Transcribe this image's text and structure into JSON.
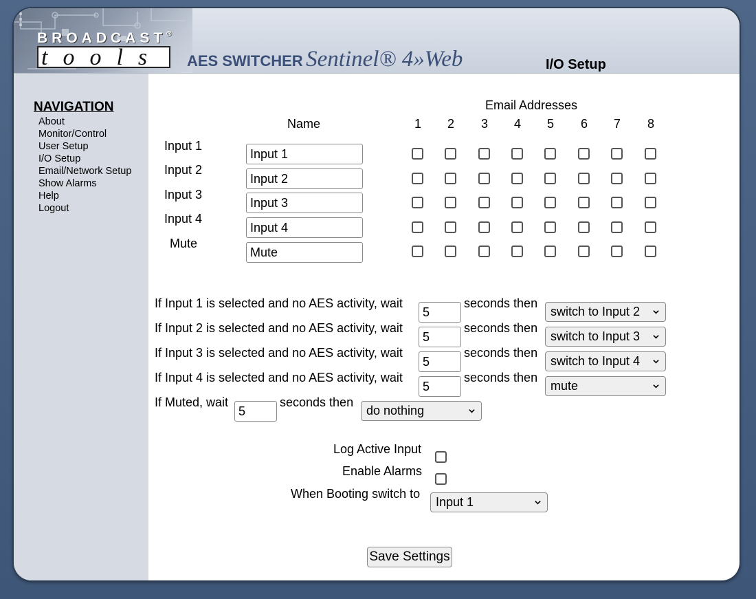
{
  "header": {
    "logo_broadcast": "BROADCAST",
    "logo_reg": "®",
    "logo_tools": "tools",
    "product_part1": "AES SWITCHER",
    "product_part2": "Sentinel® 4»Web",
    "page_title": "I/O Setup"
  },
  "nav": {
    "title": "NAVIGATION",
    "items": [
      "About",
      "Monitor/Control",
      "User Setup",
      "I/O Setup",
      "Email/Network Setup",
      "Show Alarms",
      "Help",
      "Logout"
    ]
  },
  "io_table": {
    "email_header": "Email Addresses",
    "name_header": "Name",
    "email_columns": [
      "1",
      "2",
      "3",
      "4",
      "5",
      "6",
      "7",
      "8"
    ],
    "rows": [
      {
        "label": "Input 1",
        "name": "Input 1",
        "emails": [
          false,
          false,
          false,
          false,
          false,
          false,
          false,
          false
        ]
      },
      {
        "label": "Input 2",
        "name": "Input 2",
        "emails": [
          false,
          false,
          false,
          false,
          false,
          false,
          false,
          false
        ]
      },
      {
        "label": "Input 3",
        "name": "Input 3",
        "emails": [
          false,
          false,
          false,
          false,
          false,
          false,
          false,
          false
        ]
      },
      {
        "label": "Input 4",
        "name": "Input 4",
        "emails": [
          false,
          false,
          false,
          false,
          false,
          false,
          false,
          false
        ]
      },
      {
        "label": "Mute",
        "name": "Mute",
        "emails": [
          false,
          false,
          false,
          false,
          false,
          false,
          false,
          false
        ]
      }
    ]
  },
  "failover": {
    "rules": [
      {
        "prefix": "If Input 1 is selected and no AES activity, wait",
        "seconds": "5",
        "suffix": "seconds then",
        "action": "switch to Input 2"
      },
      {
        "prefix": "If Input 2 is selected and no AES activity, wait",
        "seconds": "5",
        "suffix": "seconds then",
        "action": "switch to Input 3"
      },
      {
        "prefix": "If Input 3 is selected and no AES activity, wait",
        "seconds": "5",
        "suffix": "seconds then",
        "action": "switch to Input 4"
      },
      {
        "prefix": "If Input 4 is selected and no AES activity, wait",
        "seconds": "5",
        "suffix": "seconds then",
        "action": "mute"
      }
    ],
    "muted_rule": {
      "prefix": "If Muted, wait",
      "seconds": "5",
      "suffix": "seconds then",
      "action": "do nothing"
    }
  },
  "options": {
    "log_active_input_label": "Log Active Input",
    "log_active_input_checked": false,
    "enable_alarms_label": "Enable Alarms",
    "enable_alarms_checked": false,
    "boot_label": "When Booting switch to",
    "boot_value": "Input 1"
  },
  "save_label": "Save Settings",
  "colors": {
    "page_bg": "#455d80",
    "sidebar_bg": "#d5dae3",
    "banner_title": "#3c4f77"
  }
}
